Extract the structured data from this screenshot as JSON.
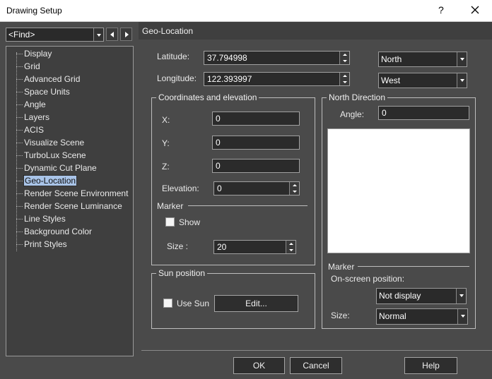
{
  "window": {
    "title": "Drawing Setup",
    "help_glyph": "?"
  },
  "find": {
    "value": "<Find>"
  },
  "section_title": "Geo-Location",
  "tree": {
    "items": [
      {
        "label": "Display"
      },
      {
        "label": "Grid"
      },
      {
        "label": "Advanced Grid"
      },
      {
        "label": "Space Units"
      },
      {
        "label": "Angle"
      },
      {
        "label": "Layers"
      },
      {
        "label": "ACIS"
      },
      {
        "label": "Visualize Scene"
      },
      {
        "label": "TurboLux Scene"
      },
      {
        "label": "Dynamic Cut Plane"
      },
      {
        "label": "Geo-Location",
        "selected": true
      },
      {
        "label": "Render Scene Environment"
      },
      {
        "label": "Render Scene Luminance"
      },
      {
        "label": "Line Styles"
      },
      {
        "label": "Background Color"
      },
      {
        "label": "Print Styles"
      }
    ]
  },
  "latitude": {
    "label": "Latitude:",
    "value": "37.794998",
    "direction": "North"
  },
  "longitude": {
    "label": "Longitude:",
    "value": "122.393997",
    "direction": "West"
  },
  "coords": {
    "title": "Coordinates and elevation",
    "x_label": "X:",
    "x_value": "0",
    "y_label": "Y:",
    "y_value": "0",
    "z_label": "Z:",
    "z_value": "0",
    "elev_label": "Elevation:",
    "elev_value": "0",
    "marker_label": "Marker",
    "show_label": "Show",
    "size_label": "Size :",
    "size_value": "20"
  },
  "sun": {
    "title": "Sun position",
    "use_sun_label": "Use Sun",
    "edit_label": "Edit..."
  },
  "north": {
    "title": "North Direction",
    "angle_label": "Angle:",
    "angle_value": "0",
    "marker_label": "Marker",
    "onscreen_label": "On-screen position:",
    "onscreen_value": "Not display",
    "size_label": "Size:",
    "size_value": "Normal"
  },
  "buttons": {
    "ok": "OK",
    "cancel": "Cancel",
    "help": "Help"
  }
}
